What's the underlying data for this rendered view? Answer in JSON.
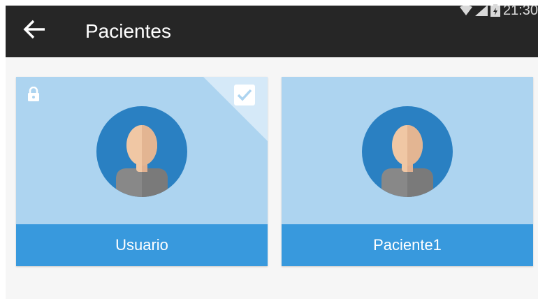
{
  "app_bar": {
    "title": "Pacientes",
    "back_icon": "arrow-back-icon",
    "background": "#262626"
  },
  "status_bar": {
    "time": "21:30",
    "icons": [
      "wifi-icon",
      "signal-icon",
      "battery-icon"
    ]
  },
  "patients": [
    {
      "name": "Usuario",
      "locked": true,
      "selected": true,
      "icons": [
        "lock-icon",
        "check-icon",
        "person-avatar-icon"
      ]
    },
    {
      "name": "Paciente1",
      "locked": false,
      "selected": false,
      "icons": [
        "person-avatar-icon"
      ]
    }
  ],
  "colors": {
    "card_background": "#add4f0",
    "card_label_bar": "#3899dd",
    "avatar_circle": "#2a80c2",
    "content_background": "#f6f6f6"
  }
}
